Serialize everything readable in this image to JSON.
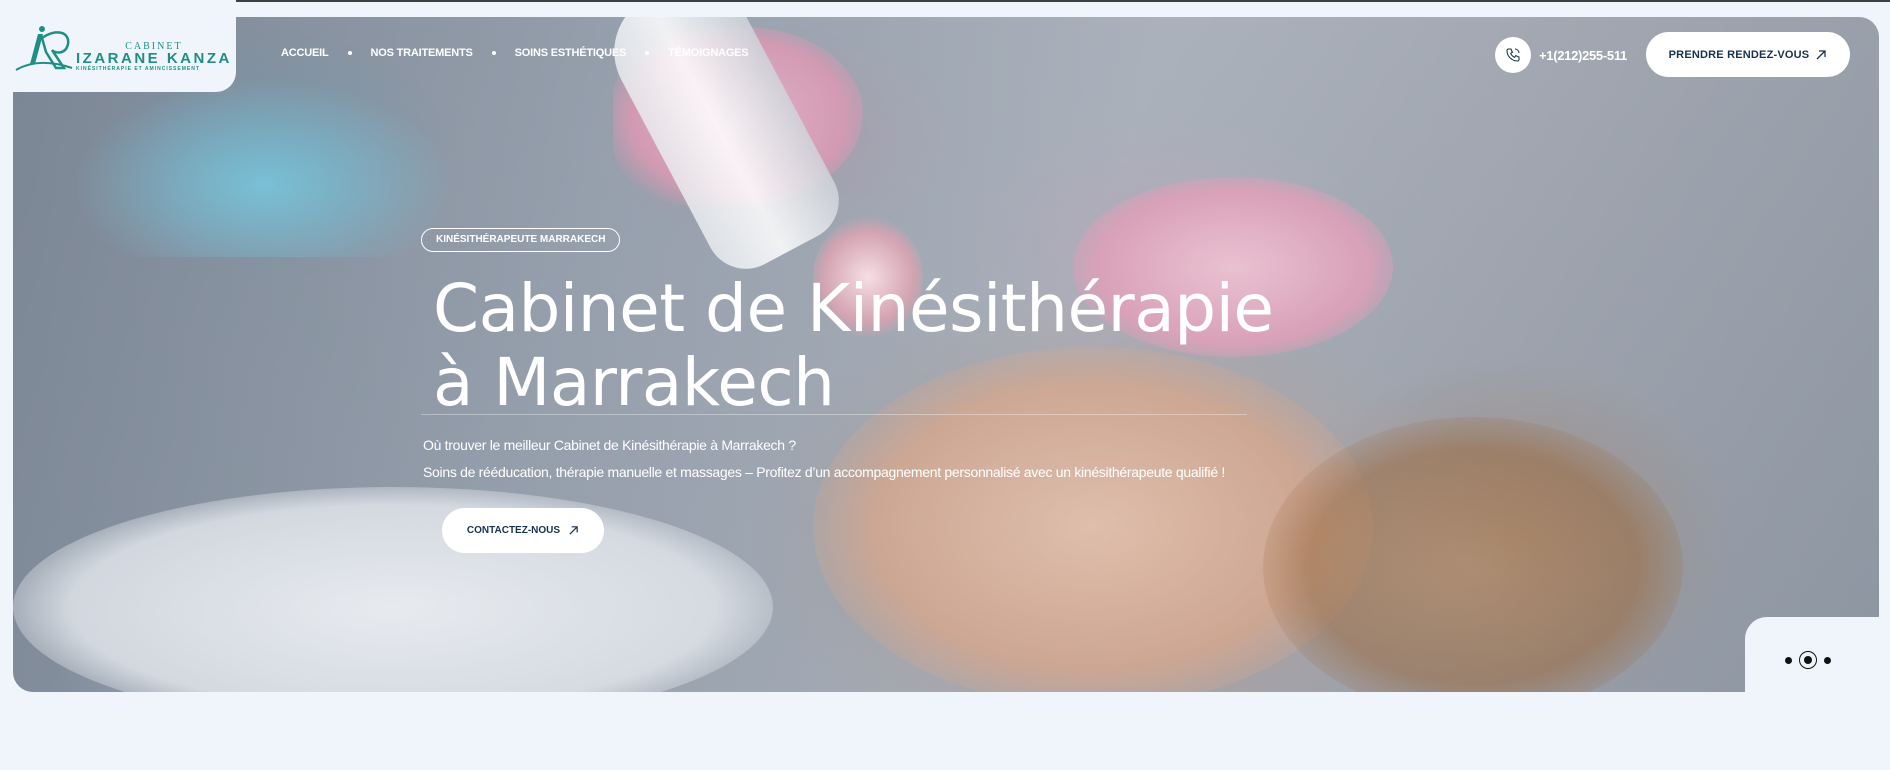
{
  "brand": {
    "cabinet": "CABINET",
    "name": "IZARANE KANZA",
    "subtitle": "KINÉSITHÉRAPIE ET AMINCISSEMENT",
    "color": "#1f8f86"
  },
  "nav": {
    "items": [
      {
        "label": "ACCUEIL"
      },
      {
        "label": "NOS TRAITEMENTS"
      },
      {
        "label": "SOINS ESTHÉTIQUES"
      },
      {
        "label": "TÉMOIGNAGES"
      }
    ]
  },
  "header": {
    "phone": "+1(212)255-511",
    "phone_icon": "phone-icon",
    "cta_label": "PRENDRE RENDEZ-VOUS",
    "cta_icon": "arrow-up-right-icon"
  },
  "hero": {
    "badge": "KINÉSITHÉRAPEUTE MARRAKECH",
    "title_line1": "Cabinet de Kinésithérapie",
    "title_line2": "à Marrakech",
    "paragraph1": "Où trouver le meilleur Cabinet de Kinésithérapie à Marrakech ?",
    "paragraph2": "Soins de rééducation, thérapie manuelle et massages – Profitez d’un accompagnement personnalisé avec un kinésithérapeute qualifié !",
    "button_label": "CONTACTEZ-NOUS"
  },
  "slider": {
    "count": 3,
    "active_index": 1
  },
  "colors": {
    "page_bg": "#f0f5fc",
    "button_text": "#17324d",
    "white": "#ffffff"
  }
}
